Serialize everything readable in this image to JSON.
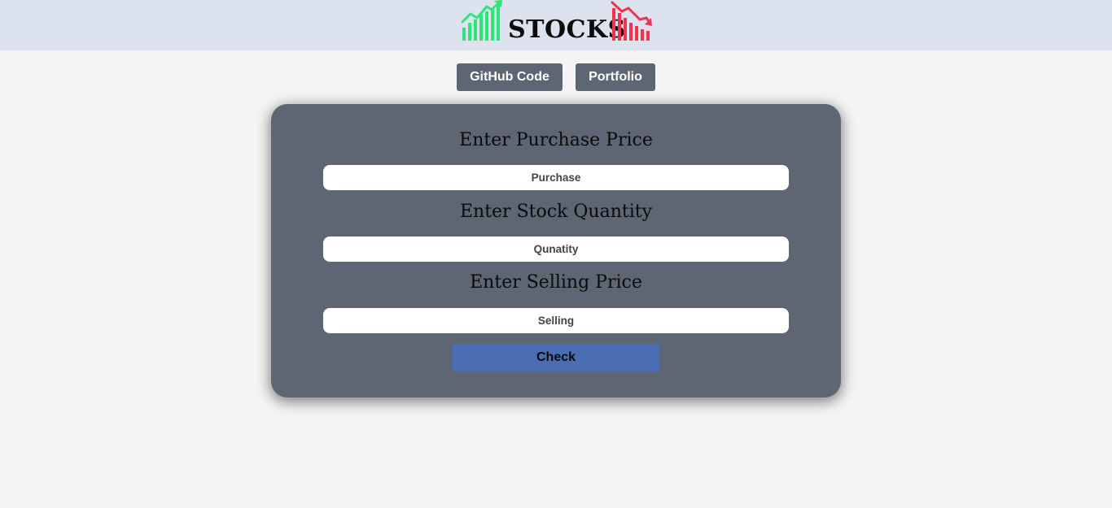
{
  "header": {
    "brand_title": "STOCKS",
    "logo_left_icon": "trending-up-bars-icon",
    "logo_right_icon": "trending-down-bars-icon",
    "logo_left_color": "#2ee57a",
    "logo_right_color": "#f0344d",
    "background": "#dce3ee"
  },
  "nav": {
    "github_label": "GitHub Code",
    "portfolio_label": "Portfolio"
  },
  "form": {
    "purchase_label": "Enter Purchase Price",
    "purchase_placeholder": "Purchase",
    "quantity_label": "Enter Stock Quantity",
    "quantity_placeholder": "Qunatity",
    "selling_label": "Enter Selling Price",
    "selling_placeholder": "Selling",
    "check_label": "Check"
  },
  "colors": {
    "card": "#5e6573",
    "button": "#5e6573",
    "check_button": "#4a6db3",
    "page_background": "#f4f4f4"
  }
}
